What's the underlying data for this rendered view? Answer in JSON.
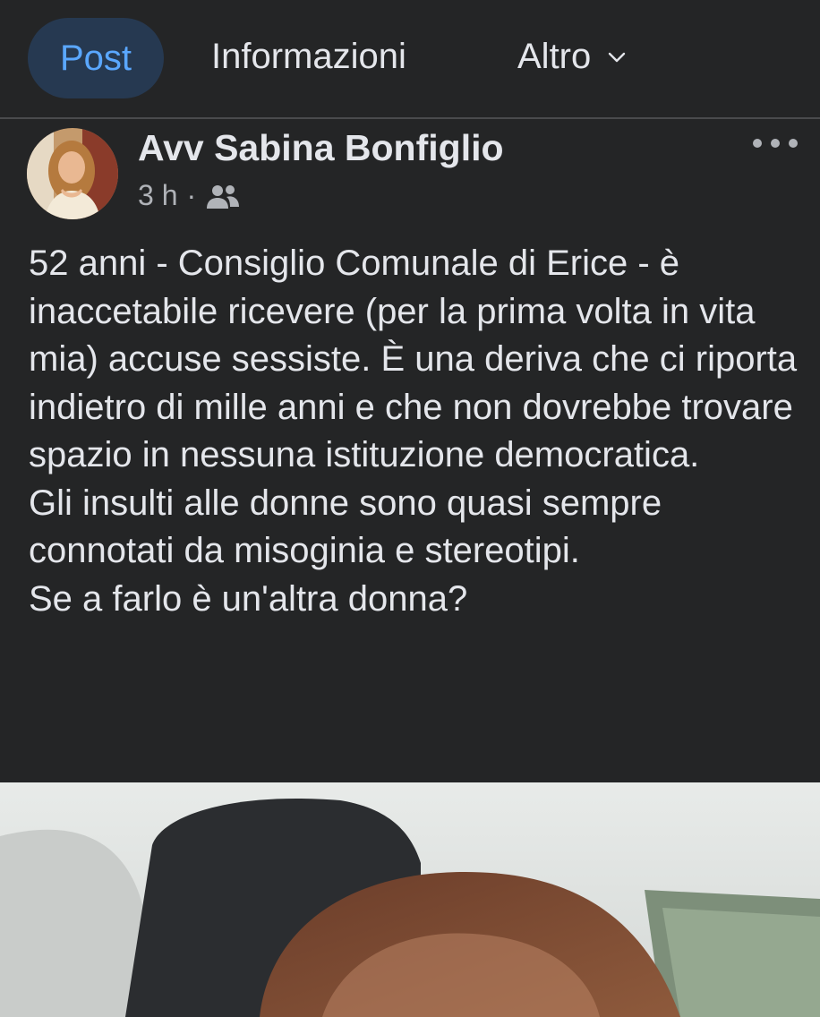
{
  "tabs": {
    "post": "Post",
    "info": "Informazioni",
    "more": "Altro"
  },
  "post": {
    "author": "Avv Sabina Bonfiglio",
    "time": "3 h",
    "separator": "·",
    "audience_icon": "friends-icon",
    "options_icon": "more-options-icon",
    "text": "52 anni - Consiglio Comunale di Erice - è inaccetabile ricevere (per la prima volta in vita mia) accuse sessiste. È una deriva che ci riporta indietro di mille anni e che non dovrebbe trovare spazio in nessuna istituzione democratica.\nGli insulti alle donne sono quasi sempre connotati da misoginia e stereotipi.\nSe a farlo è un'altra donna?"
  },
  "colors": {
    "background": "#242526",
    "active_tab_bg": "#263951",
    "active_tab_text": "#5aa7ff",
    "primary_text": "#e4e6eb",
    "secondary_text": "#b0b3b8"
  }
}
